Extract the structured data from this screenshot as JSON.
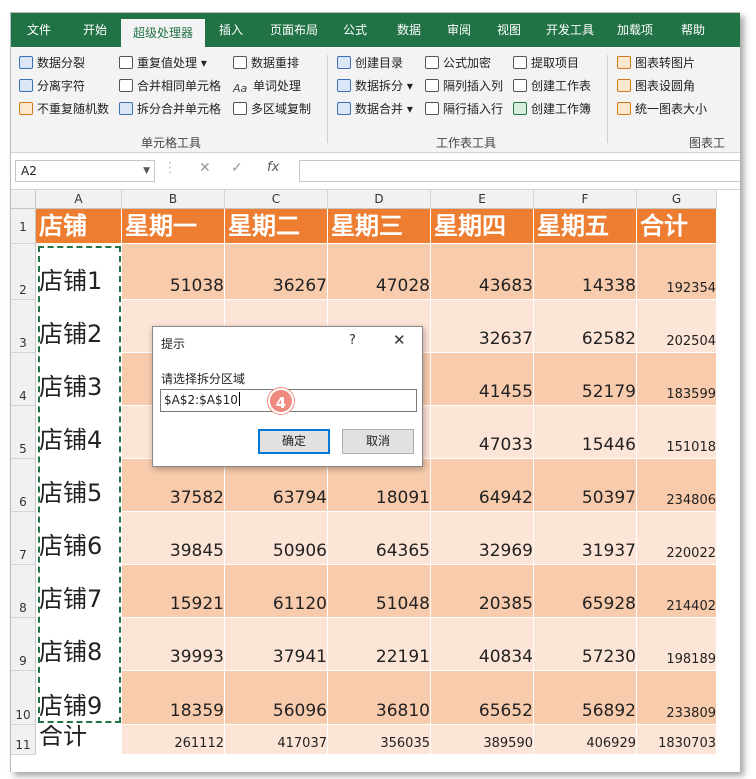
{
  "ribbon": {
    "tabs": [
      "文件",
      "开始",
      "超级处理器",
      "插入",
      "页面布局",
      "公式",
      "数据",
      "审阅",
      "视图",
      "开发工具",
      "加载项",
      "帮助"
    ],
    "active_tab": "超级处理器",
    "groups": {
      "cell_tools": {
        "label": "单元格工具",
        "buttons": [
          "数据分裂",
          "分离字符",
          "不重复随机数",
          "重复值处理",
          "合并相同单元格",
          "拆分合并单元格",
          "数据重排",
          "单词处理",
          "多区域复制"
        ]
      },
      "sheet_tools": {
        "label": "工作表工具",
        "buttons": [
          "创建目录",
          "数据拆分",
          "数据合并",
          "公式加密",
          "隔列插入列",
          "隔行插入行",
          "提取项目",
          "创建工作表",
          "创建工作簿"
        ]
      },
      "chart_tools": {
        "label": "图表工",
        "buttons": [
          "图表转图片",
          "图表设圆角",
          "统一图表大小"
        ]
      }
    }
  },
  "formula_bar": {
    "name_box": "A2",
    "cancel_icon": "✕",
    "enter_icon": "✓",
    "fx_label": "fx",
    "formula": ""
  },
  "grid": {
    "columns": [
      "A",
      "B",
      "C",
      "D",
      "E",
      "F",
      "G"
    ],
    "header_row": [
      "店铺",
      "星期一",
      "星期二",
      "星期三",
      "星期四",
      "星期五",
      "合计"
    ],
    "rows": [
      {
        "n": "2",
        "cells": [
          "店铺1",
          "51038",
          "36267",
          "47028",
          "43683",
          "14338",
          "192354"
        ]
      },
      {
        "n": "3",
        "cells": [
          "店铺2",
          "",
          "",
          "",
          "32637",
          "62582",
          "202504"
        ]
      },
      {
        "n": "4",
        "cells": [
          "店铺3",
          "",
          "",
          "",
          "41455",
          "52179",
          "183599"
        ]
      },
      {
        "n": "5",
        "cells": [
          "店铺4",
          "",
          "",
          "",
          "47033",
          "15446",
          "151018"
        ]
      },
      {
        "n": "6",
        "cells": [
          "店铺5",
          "37582",
          "63794",
          "18091",
          "64942",
          "50397",
          "234806"
        ]
      },
      {
        "n": "7",
        "cells": [
          "店铺6",
          "39845",
          "50906",
          "64365",
          "32969",
          "31937",
          "220022"
        ]
      },
      {
        "n": "8",
        "cells": [
          "店铺7",
          "15921",
          "61120",
          "51048",
          "20385",
          "65928",
          "214402"
        ]
      },
      {
        "n": "9",
        "cells": [
          "店铺8",
          "39993",
          "37941",
          "22191",
          "40834",
          "57230",
          "198189"
        ]
      },
      {
        "n": "10",
        "cells": [
          "店铺9",
          "18359",
          "56096",
          "36810",
          "65652",
          "56892",
          "233809"
        ]
      },
      {
        "n": "11",
        "cells": [
          "合计",
          "261112",
          "417037",
          "356035",
          "389590",
          "406929",
          "1830703"
        ]
      }
    ],
    "colors": {
      "header": "#ed7d31",
      "band_dark": "#f8cbad",
      "band_light": "#fce4d6"
    }
  },
  "dialog": {
    "title": "提示",
    "help": "?",
    "close": "✕",
    "prompt": "请选择拆分区域",
    "value": "$A$2:$A$10",
    "step_badge": "4",
    "ok": "确定",
    "cancel": "取消"
  }
}
